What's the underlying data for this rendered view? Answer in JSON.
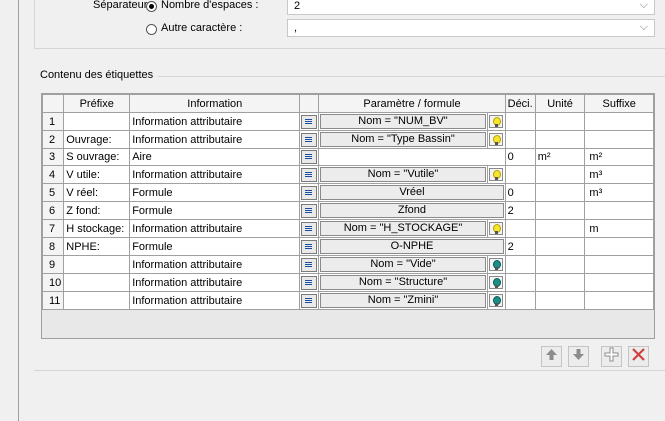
{
  "separator": {
    "label": "Séparateur :",
    "options": [
      {
        "label": "Nombre d'espaces :",
        "selected": true,
        "value": "2"
      },
      {
        "label": "Autre caractère :",
        "selected": false,
        "value": ","
      }
    ]
  },
  "group": {
    "title": "Contenu des étiquettes"
  },
  "table": {
    "headers": [
      "Préfixe",
      "Information",
      "Paramètre / formule",
      "Déci.",
      "Unité",
      "Suffixe"
    ],
    "rows": [
      {
        "n": "1",
        "prefix": "",
        "info": "Information attributaire",
        "param": "Nom = \"NUM_BV\"",
        "bulb": "yellow",
        "deci": "",
        "unit": "",
        "suffix": ""
      },
      {
        "n": "2",
        "prefix": "Ouvrage:",
        "info": "Information attributaire",
        "param": "Nom = \"Type Bassin\"",
        "bulb": "yellow",
        "deci": "",
        "unit": "",
        "suffix": ""
      },
      {
        "n": "3",
        "prefix": "S ouvrage:",
        "info": "Aire",
        "param": "",
        "bulb": "",
        "deci": "0",
        "unit": "m²",
        "suffix": "m²"
      },
      {
        "n": "4",
        "prefix": "V utile:",
        "info": "Information attributaire",
        "param": "Nom = \"Vutile\"",
        "bulb": "yellow",
        "deci": "",
        "unit": "",
        "suffix": "m³"
      },
      {
        "n": "5",
        "prefix": "V réel:",
        "info": "Formule",
        "param": "Vréel",
        "bulb": "",
        "deci": "0",
        "unit": "",
        "suffix": "m³"
      },
      {
        "n": "6",
        "prefix": "Z fond:",
        "info": "Formule",
        "param": "Zfond",
        "bulb": "",
        "deci": "2",
        "unit": "",
        "suffix": ""
      },
      {
        "n": "7",
        "prefix": "H stockage:",
        "info": "Information attributaire",
        "param": "Nom = \"H_STOCKAGE\"",
        "bulb": "yellow",
        "deci": "",
        "unit": "",
        "suffix": "m"
      },
      {
        "n": "8",
        "prefix": "NPHE:",
        "info": "Formule",
        "param": "O-NPHE",
        "bulb": "",
        "deci": "2",
        "unit": "",
        "suffix": ""
      },
      {
        "n": "9",
        "prefix": "",
        "info": "Information attributaire",
        "param": "Nom = \"Vide\"",
        "bulb": "teal",
        "deci": "",
        "unit": "",
        "suffix": ""
      },
      {
        "n": "10",
        "prefix": "",
        "info": "Information attributaire",
        "param": "Nom = \"Structure\"",
        "bulb": "teal",
        "deci": "",
        "unit": "",
        "suffix": ""
      },
      {
        "n": "11",
        "prefix": "",
        "info": "Information attributaire",
        "param": "Nom = \"Zmini\"",
        "bulb": "teal",
        "deci": "",
        "unit": "",
        "suffix": ""
      }
    ]
  },
  "toolbar": {
    "icons": [
      "arrow-up-icon",
      "arrow-down-icon",
      "add-icon",
      "delete-icon"
    ],
    "colors": {
      "up_down": "#8c8c8c",
      "add": "#8c8c8c",
      "delete": "#d04040"
    }
  }
}
